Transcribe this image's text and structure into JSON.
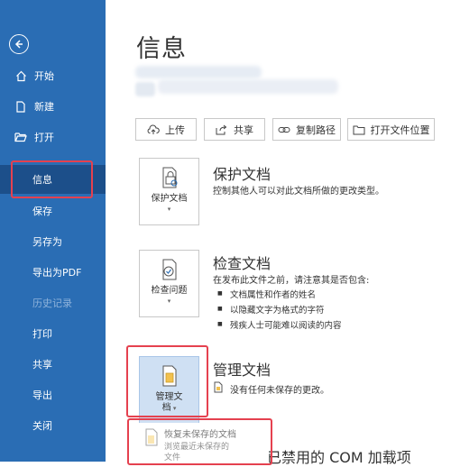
{
  "sidebar": {
    "items": [
      {
        "label": "开始",
        "icon": "home-icon"
      },
      {
        "label": "新建",
        "icon": "new-document-icon"
      },
      {
        "label": "打开",
        "icon": "folder-open-icon"
      },
      {
        "label": "信息"
      },
      {
        "label": "保存"
      },
      {
        "label": "另存为"
      },
      {
        "label": "导出为PDF"
      },
      {
        "label": "历史记录"
      },
      {
        "label": "打印"
      },
      {
        "label": "共享"
      },
      {
        "label": "导出"
      },
      {
        "label": "关闭"
      }
    ]
  },
  "main": {
    "title": "信息",
    "toolbar": {
      "upload": "上传",
      "share": "共享",
      "copy_path": "复制路径",
      "open_location": "打开文件位置"
    },
    "sections": {
      "protect": {
        "card_label": "保护文档",
        "title": "保护文档",
        "desc": "控制其他人可以对此文档所做的更改类型。"
      },
      "inspect": {
        "card_label": "检查问题",
        "title": "检查文档",
        "desc": "在发布此文件之前，请注意其是否包含:",
        "bullets": [
          "文档属性和作者的姓名",
          "以隐藏文字为格式的字符",
          "残疾人士可能难以阅读的内容"
        ]
      },
      "manage": {
        "card_label_1": "管理文",
        "card_label_2": "档",
        "title": "管理文档",
        "desc": "没有任何未保存的更改。"
      },
      "com": {
        "title": "已禁用的 COM 加载项"
      }
    },
    "dropdown": {
      "title": "恢复未保存的文档",
      "desc_1": "浏览最近未保存的",
      "desc_2": "文件"
    }
  },
  "colors": {
    "sidebar": "#2a6db4",
    "sidebar_active": "#1c4f8a",
    "highlight": "#e5414f"
  }
}
